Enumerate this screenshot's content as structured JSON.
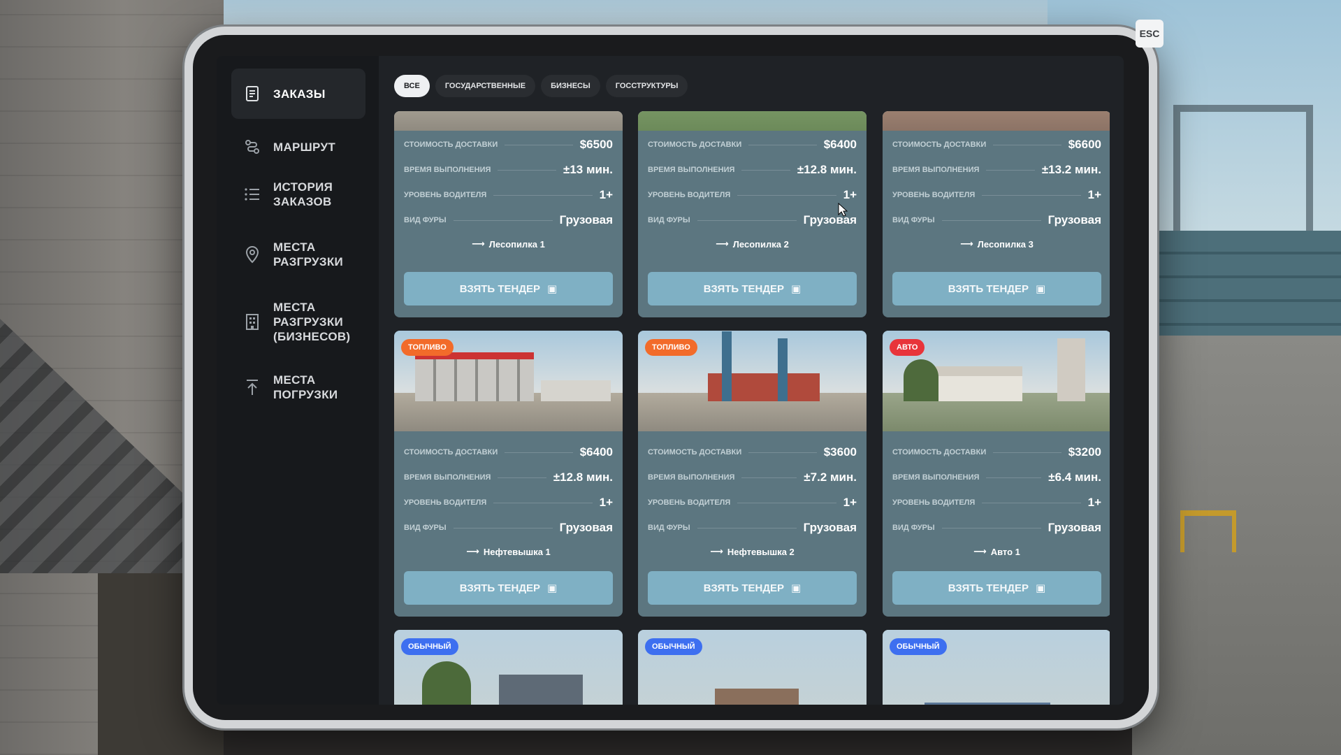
{
  "esc_label": "ESC",
  "sidebar": {
    "items": [
      {
        "label": "ЗАКАЗЫ",
        "icon": "clipboard-icon",
        "active": true
      },
      {
        "label": "МАРШРУТ",
        "icon": "route-icon"
      },
      {
        "label": "ИСТОРИЯ ЗАКАЗОВ",
        "icon": "list-icon"
      },
      {
        "label": "МЕСТА РАЗГРУЗКИ",
        "icon": "map-pin-icon"
      },
      {
        "label": "МЕСТА РАЗГРУЗКИ (БИЗНЕСОВ)",
        "icon": "building-icon"
      },
      {
        "label": "МЕСТА ПОГРУЗКИ",
        "icon": "upload-icon"
      }
    ]
  },
  "tabs": [
    {
      "label": "ВСЕ",
      "active": true
    },
    {
      "label": "ГОСУДАРСТВЕННЫЕ"
    },
    {
      "label": "БИЗНЕСЫ"
    },
    {
      "label": "ГОССТРУКТУРЫ"
    }
  ],
  "card_labels": {
    "cost": "СТОИМОСТЬ ДОСТАВКИ",
    "time": "ВРЕМЯ ВЫПОЛНЕНИЯ",
    "level": "УРОВЕНЬ ВОДИТЕЛЯ",
    "truck": "ВИД ФУРЫ",
    "button": "ВЗЯТЬ ТЕНДЕР"
  },
  "cards": [
    {
      "cost": "$6500",
      "time": "±13 мин.",
      "level": "1+",
      "truck": "Грузовая",
      "destination": "Лесопилка 1"
    },
    {
      "cost": "$6400",
      "time": "±12.8 мин.",
      "level": "1+",
      "truck": "Грузовая",
      "destination": "Лесопилка 2"
    },
    {
      "cost": "$6600",
      "time": "±13.2 мин.",
      "level": "1+",
      "truck": "Грузовая",
      "destination": "Лесопилка 3"
    },
    {
      "badge": "ТОПЛИВО",
      "badge_color": "#f26b2a",
      "cost": "$6400",
      "time": "±12.8 мин.",
      "level": "1+",
      "truck": "Грузовая",
      "destination": "Нефтевышка 1"
    },
    {
      "badge": "ТОПЛИВО",
      "badge_color": "#f26b2a",
      "cost": "$3600",
      "time": "±7.2 мин.",
      "level": "1+",
      "truck": "Грузовая",
      "destination": "Нефтевышка 2"
    },
    {
      "badge": "АВТО",
      "badge_color": "#e8343a",
      "cost": "$3200",
      "time": "±6.4 мин.",
      "level": "1+",
      "truck": "Грузовая",
      "destination": "Авто 1"
    },
    {
      "badge": "ОБЫЧНЫЙ",
      "badge_color": "#3d6ff0"
    },
    {
      "badge": "ОБЫЧНЫЙ",
      "badge_color": "#3d6ff0"
    },
    {
      "badge": "ОБЫЧНЫЙ",
      "badge_color": "#3d6ff0"
    }
  ]
}
